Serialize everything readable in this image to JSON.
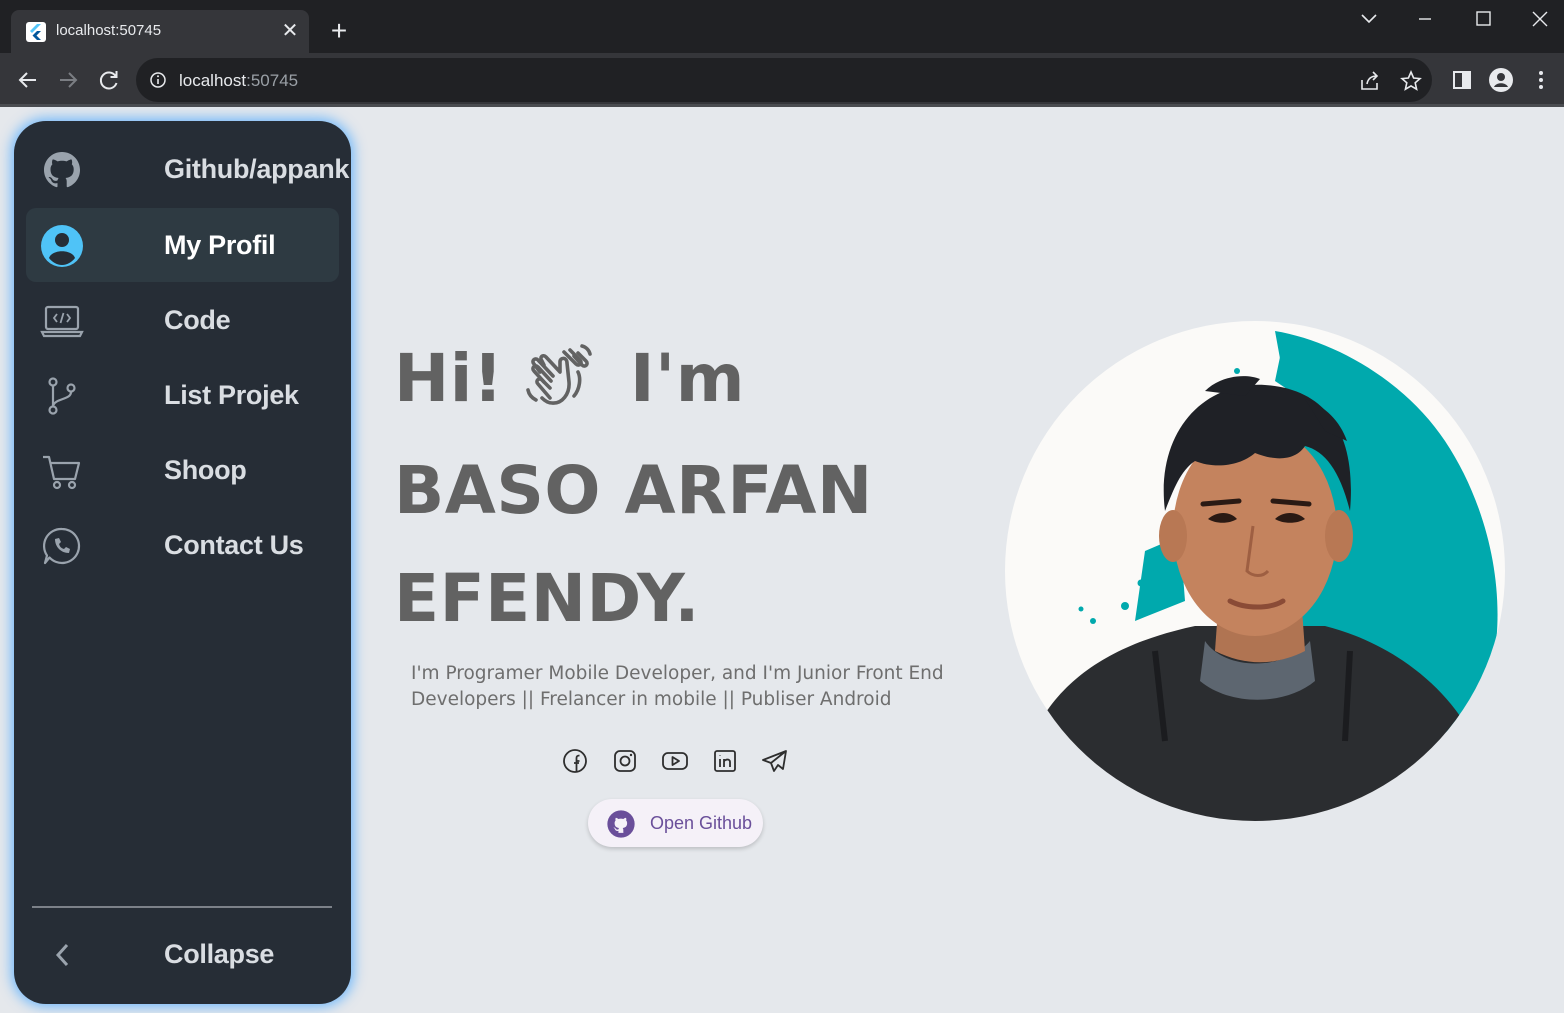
{
  "browser": {
    "tab_title": "localhost:50745",
    "url_host": "localhost",
    "url_port": ":50745"
  },
  "sidebar": {
    "items": [
      {
        "label": "Github/appank",
        "icon": "github-icon"
      },
      {
        "label": "My Profil",
        "icon": "account-circle-icon",
        "active": true
      },
      {
        "label": "Code",
        "icon": "laptop-code-icon"
      },
      {
        "label": "List Projek",
        "icon": "git-branch-icon"
      },
      {
        "label": "Shoop",
        "icon": "shopping-cart-icon"
      },
      {
        "label": "Contact Us",
        "icon": "whatsapp-icon"
      }
    ],
    "collapse_label": "Collapse"
  },
  "hero": {
    "greeting": "Hi!",
    "im": "I'm",
    "name_line1": "BASO ARFAN",
    "name_line2": "EFENDY.",
    "bio": "I'm Programer Mobile Developer, and I'm Junior Front End Developers || Frelancer in mobile || Publiser Android",
    "github_button_label": "Open Github"
  },
  "social": [
    "facebook-icon",
    "instagram-icon",
    "youtube-icon",
    "linkedin-icon",
    "telegram-icon"
  ],
  "colors": {
    "sidebar_bg": "#262d36",
    "sidebar_glow": "#4daaff",
    "active_icon": "#4fc3f7",
    "hero_text": "#626262",
    "page_bg": "#e5e8ec",
    "avatar_accent": "#00a9ad",
    "button_text": "#6a4f9a"
  }
}
